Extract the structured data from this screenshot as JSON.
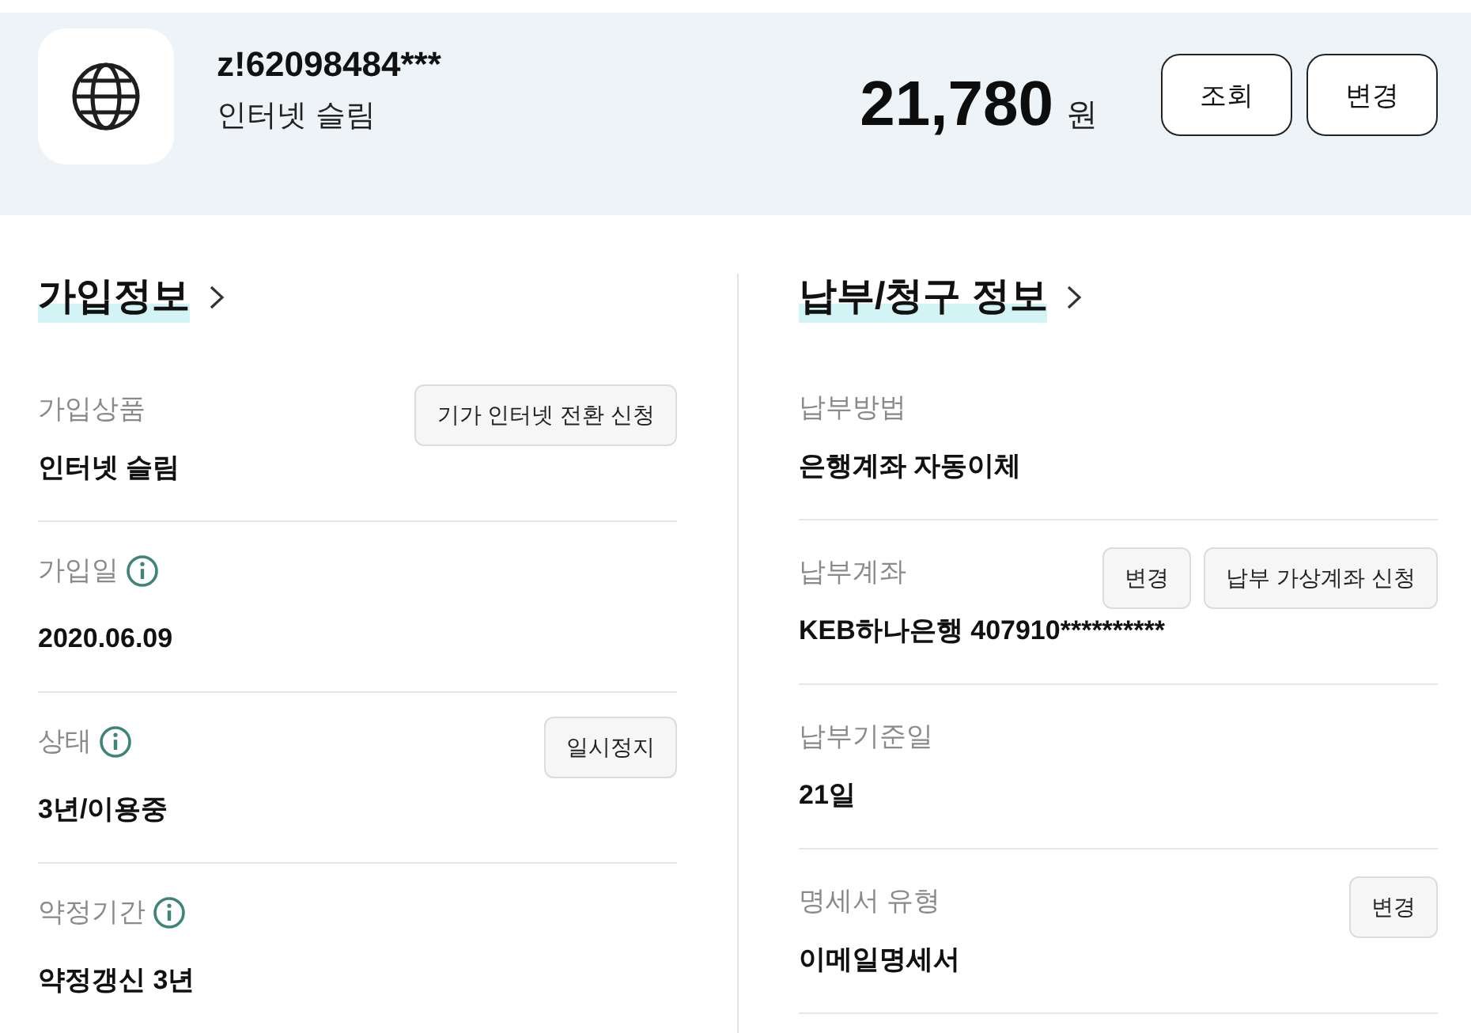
{
  "header": {
    "account": "z!62098484***",
    "product": "인터넷 슬림",
    "amount": "21,780",
    "currency": "원",
    "buttons": [
      {
        "label": "조회"
      },
      {
        "label": "변경"
      }
    ]
  },
  "sections": [
    {
      "title": "가입정보",
      "rows": [
        {
          "label": "가입상품",
          "info": false,
          "value": "인터넷 슬림",
          "buttons": [
            {
              "label": "기가 인터넷 전환 신청"
            }
          ]
        },
        {
          "label": "가입일",
          "info": true,
          "value": "2020.06.09"
        },
        {
          "label": "상태",
          "info": true,
          "value": "3년/이용중",
          "buttons": [
            {
              "label": "일시정지"
            }
          ]
        },
        {
          "label": "약정기간",
          "info": true,
          "value": "약정갱신 3년"
        }
      ]
    },
    {
      "title": "납부/청구 정보",
      "rows": [
        {
          "label": "납부방법",
          "info": false,
          "value": "은행계좌 자동이체"
        },
        {
          "label": "납부계좌",
          "info": false,
          "value": "KEB하나은행 407910**********",
          "buttons": [
            {
              "label": "변경"
            },
            {
              "label": "납부 가상계좌 신청"
            }
          ]
        },
        {
          "label": "납부기준일",
          "info": false,
          "value": "21일"
        },
        {
          "label": "명세서 유형",
          "info": false,
          "value": "이메일명세서",
          "buttons": [
            {
              "label": "변경"
            }
          ]
        }
      ]
    }
  ]
}
